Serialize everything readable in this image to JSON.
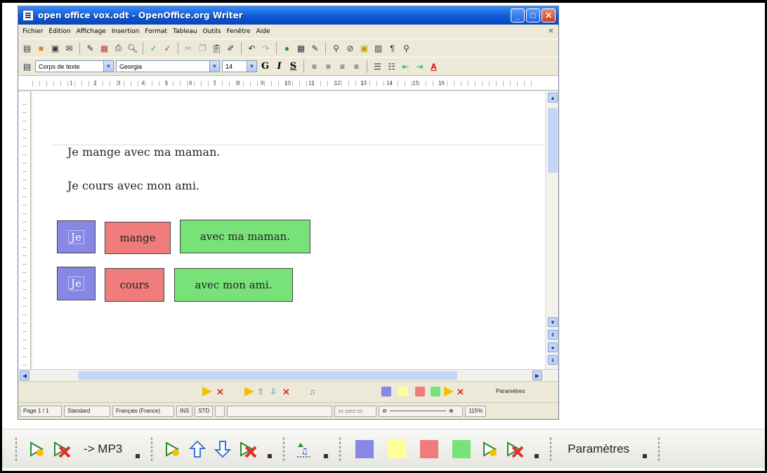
{
  "window": {
    "title": "open office vox.odt - OpenOffice.org Writer",
    "menu": [
      "Fichier",
      "Édition",
      "Affichage",
      "Insertion",
      "Format",
      "Tableau",
      "Outils",
      "Fenêtre",
      "Aide"
    ],
    "menu_close": "×"
  },
  "formatting": {
    "style": "Corps de texte",
    "font": "Georgia",
    "size": "14",
    "bold": "G",
    "italic": "I",
    "underline": "S"
  },
  "ruler_labels": [
    "1",
    "2",
    "3",
    "4",
    "5",
    "6",
    "7",
    "8",
    "9",
    "10",
    "11",
    "12",
    "13",
    "14",
    "15",
    "16"
  ],
  "document": {
    "line1": "Je mange avec ma maman.",
    "line2": "Je cours avec mon ami.",
    "row1": [
      "Je",
      "mange",
      "avec ma maman."
    ],
    "row2": [
      "Je",
      "cours",
      "avec mon ami."
    ]
  },
  "mini_toolbar": {
    "params": "Paramètres"
  },
  "status": {
    "page": "Page 1 / 1",
    "style": "Standard",
    "lang": "Français (France)",
    "ins": "INS",
    "std": "STD",
    "zoom": "115%"
  },
  "big_toolbar": {
    "mp3": "-> MP3",
    "params": "Paramètres"
  },
  "colors": {
    "blue": "#8787e6",
    "yellow": "#ffff99",
    "red": "#f07b7b",
    "green": "#78e278",
    "play": "#f2c200",
    "delete": "#e03030"
  }
}
